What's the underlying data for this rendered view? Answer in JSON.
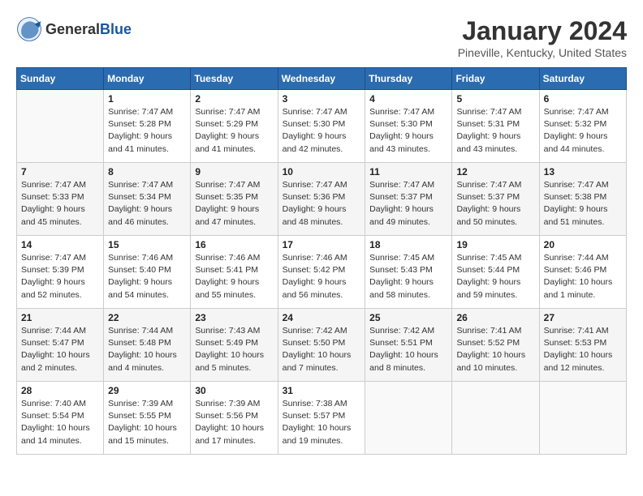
{
  "header": {
    "logo": {
      "general": "General",
      "blue": "Blue"
    },
    "title": "January 2024",
    "subtitle": "Pineville, Kentucky, United States"
  },
  "calendar": {
    "days_of_week": [
      "Sunday",
      "Monday",
      "Tuesday",
      "Wednesday",
      "Thursday",
      "Friday",
      "Saturday"
    ],
    "weeks": [
      [
        {
          "day": "",
          "info": ""
        },
        {
          "day": "1",
          "info": "Sunrise: 7:47 AM\nSunset: 5:28 PM\nDaylight: 9 hours\nand 41 minutes."
        },
        {
          "day": "2",
          "info": "Sunrise: 7:47 AM\nSunset: 5:29 PM\nDaylight: 9 hours\nand 41 minutes."
        },
        {
          "day": "3",
          "info": "Sunrise: 7:47 AM\nSunset: 5:30 PM\nDaylight: 9 hours\nand 42 minutes."
        },
        {
          "day": "4",
          "info": "Sunrise: 7:47 AM\nSunset: 5:30 PM\nDaylight: 9 hours\nand 43 minutes."
        },
        {
          "day": "5",
          "info": "Sunrise: 7:47 AM\nSunset: 5:31 PM\nDaylight: 9 hours\nand 43 minutes."
        },
        {
          "day": "6",
          "info": "Sunrise: 7:47 AM\nSunset: 5:32 PM\nDaylight: 9 hours\nand 44 minutes."
        }
      ],
      [
        {
          "day": "7",
          "info": "Sunrise: 7:47 AM\nSunset: 5:33 PM\nDaylight: 9 hours\nand 45 minutes."
        },
        {
          "day": "8",
          "info": "Sunrise: 7:47 AM\nSunset: 5:34 PM\nDaylight: 9 hours\nand 46 minutes."
        },
        {
          "day": "9",
          "info": "Sunrise: 7:47 AM\nSunset: 5:35 PM\nDaylight: 9 hours\nand 47 minutes."
        },
        {
          "day": "10",
          "info": "Sunrise: 7:47 AM\nSunset: 5:36 PM\nDaylight: 9 hours\nand 48 minutes."
        },
        {
          "day": "11",
          "info": "Sunrise: 7:47 AM\nSunset: 5:37 PM\nDaylight: 9 hours\nand 49 minutes."
        },
        {
          "day": "12",
          "info": "Sunrise: 7:47 AM\nSunset: 5:37 PM\nDaylight: 9 hours\nand 50 minutes."
        },
        {
          "day": "13",
          "info": "Sunrise: 7:47 AM\nSunset: 5:38 PM\nDaylight: 9 hours\nand 51 minutes."
        }
      ],
      [
        {
          "day": "14",
          "info": "Sunrise: 7:47 AM\nSunset: 5:39 PM\nDaylight: 9 hours\nand 52 minutes."
        },
        {
          "day": "15",
          "info": "Sunrise: 7:46 AM\nSunset: 5:40 PM\nDaylight: 9 hours\nand 54 minutes."
        },
        {
          "day": "16",
          "info": "Sunrise: 7:46 AM\nSunset: 5:41 PM\nDaylight: 9 hours\nand 55 minutes."
        },
        {
          "day": "17",
          "info": "Sunrise: 7:46 AM\nSunset: 5:42 PM\nDaylight: 9 hours\nand 56 minutes."
        },
        {
          "day": "18",
          "info": "Sunrise: 7:45 AM\nSunset: 5:43 PM\nDaylight: 9 hours\nand 58 minutes."
        },
        {
          "day": "19",
          "info": "Sunrise: 7:45 AM\nSunset: 5:44 PM\nDaylight: 9 hours\nand 59 minutes."
        },
        {
          "day": "20",
          "info": "Sunrise: 7:44 AM\nSunset: 5:46 PM\nDaylight: 10 hours\nand 1 minute."
        }
      ],
      [
        {
          "day": "21",
          "info": "Sunrise: 7:44 AM\nSunset: 5:47 PM\nDaylight: 10 hours\nand 2 minutes."
        },
        {
          "day": "22",
          "info": "Sunrise: 7:44 AM\nSunset: 5:48 PM\nDaylight: 10 hours\nand 4 minutes."
        },
        {
          "day": "23",
          "info": "Sunrise: 7:43 AM\nSunset: 5:49 PM\nDaylight: 10 hours\nand 5 minutes."
        },
        {
          "day": "24",
          "info": "Sunrise: 7:42 AM\nSunset: 5:50 PM\nDaylight: 10 hours\nand 7 minutes."
        },
        {
          "day": "25",
          "info": "Sunrise: 7:42 AM\nSunset: 5:51 PM\nDaylight: 10 hours\nand 8 minutes."
        },
        {
          "day": "26",
          "info": "Sunrise: 7:41 AM\nSunset: 5:52 PM\nDaylight: 10 hours\nand 10 minutes."
        },
        {
          "day": "27",
          "info": "Sunrise: 7:41 AM\nSunset: 5:53 PM\nDaylight: 10 hours\nand 12 minutes."
        }
      ],
      [
        {
          "day": "28",
          "info": "Sunrise: 7:40 AM\nSunset: 5:54 PM\nDaylight: 10 hours\nand 14 minutes."
        },
        {
          "day": "29",
          "info": "Sunrise: 7:39 AM\nSunset: 5:55 PM\nDaylight: 10 hours\nand 15 minutes."
        },
        {
          "day": "30",
          "info": "Sunrise: 7:39 AM\nSunset: 5:56 PM\nDaylight: 10 hours\nand 17 minutes."
        },
        {
          "day": "31",
          "info": "Sunrise: 7:38 AM\nSunset: 5:57 PM\nDaylight: 10 hours\nand 19 minutes."
        },
        {
          "day": "",
          "info": ""
        },
        {
          "day": "",
          "info": ""
        },
        {
          "day": "",
          "info": ""
        }
      ]
    ]
  }
}
